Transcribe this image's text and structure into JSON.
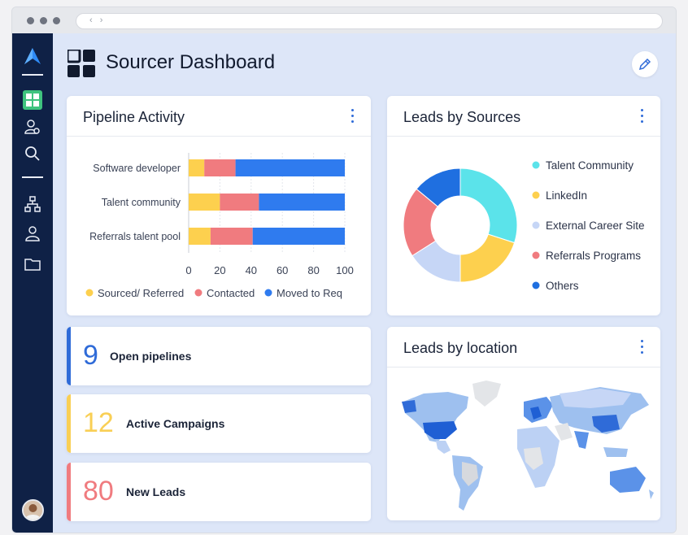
{
  "page": {
    "title": "Sourcer Dashboard"
  },
  "browser": {
    "address_arrows": "‹ ›"
  },
  "sidebar": {
    "items": [
      {
        "name": "dashboard-icon",
        "active": true
      },
      {
        "name": "user-settings-icon"
      },
      {
        "name": "search-icon"
      },
      {
        "name": "org-chart-icon"
      },
      {
        "name": "user-icon"
      },
      {
        "name": "folder-icon"
      }
    ]
  },
  "pipeline": {
    "title": "Pipeline Activity",
    "categories": [
      "Software developer",
      "Talent community",
      "Referrals talent pool"
    ],
    "ticks": [
      "0",
      "20",
      "40",
      "60",
      "80",
      "100"
    ],
    "legend": [
      "Sourced/ Referred",
      "Contacted",
      "Moved to Req"
    ]
  },
  "chart_data": [
    {
      "type": "bar",
      "title": "Pipeline Activity",
      "orientation": "horizontal",
      "stacked": true,
      "categories": [
        "Software developer",
        "Talent community",
        "Referrals talent pool"
      ],
      "xlim": [
        0,
        100
      ],
      "series": [
        {
          "name": "Sourced/ Referred",
          "color": "#fdd04e",
          "values": [
            10,
            20,
            14
          ]
        },
        {
          "name": "Contacted",
          "color": "#f07b7f",
          "values": [
            20,
            25,
            27
          ]
        },
        {
          "name": "Moved to Req",
          "color": "#2f7bef",
          "values": [
            70,
            55,
            59
          ]
        }
      ],
      "legend_position": "bottom"
    },
    {
      "type": "pie",
      "donut": true,
      "title": "Leads by Sources",
      "labels": [
        "Talent Community",
        "LinkedIn",
        "External Career Site",
        "Referrals Programs",
        "Others"
      ],
      "values": [
        30,
        20,
        16,
        20,
        14
      ],
      "colors": [
        "#5be3ea",
        "#fdd04e",
        "#c6d6f6",
        "#f07b7f",
        "#1f6fe0"
      ],
      "legend_position": "right"
    }
  ],
  "sources": {
    "title": "Leads by Sources",
    "legend": [
      "Talent Community",
      "LinkedIn",
      "External Career Site",
      "Referrals Programs",
      "Others"
    ]
  },
  "location": {
    "title": "Leads by location"
  },
  "stats": [
    {
      "value": "9",
      "label": "Open pipelines",
      "color": "#2f6bd8"
    },
    {
      "value": "12",
      "label": "Active Campaigns",
      "color": "#f9cf55"
    },
    {
      "value": "80",
      "label": "New Leads",
      "color": "#f07b7f"
    }
  ],
  "colors": {
    "accent": "#2f6bd8",
    "sidebar": "#0f2146",
    "active": "#3fc37e"
  }
}
